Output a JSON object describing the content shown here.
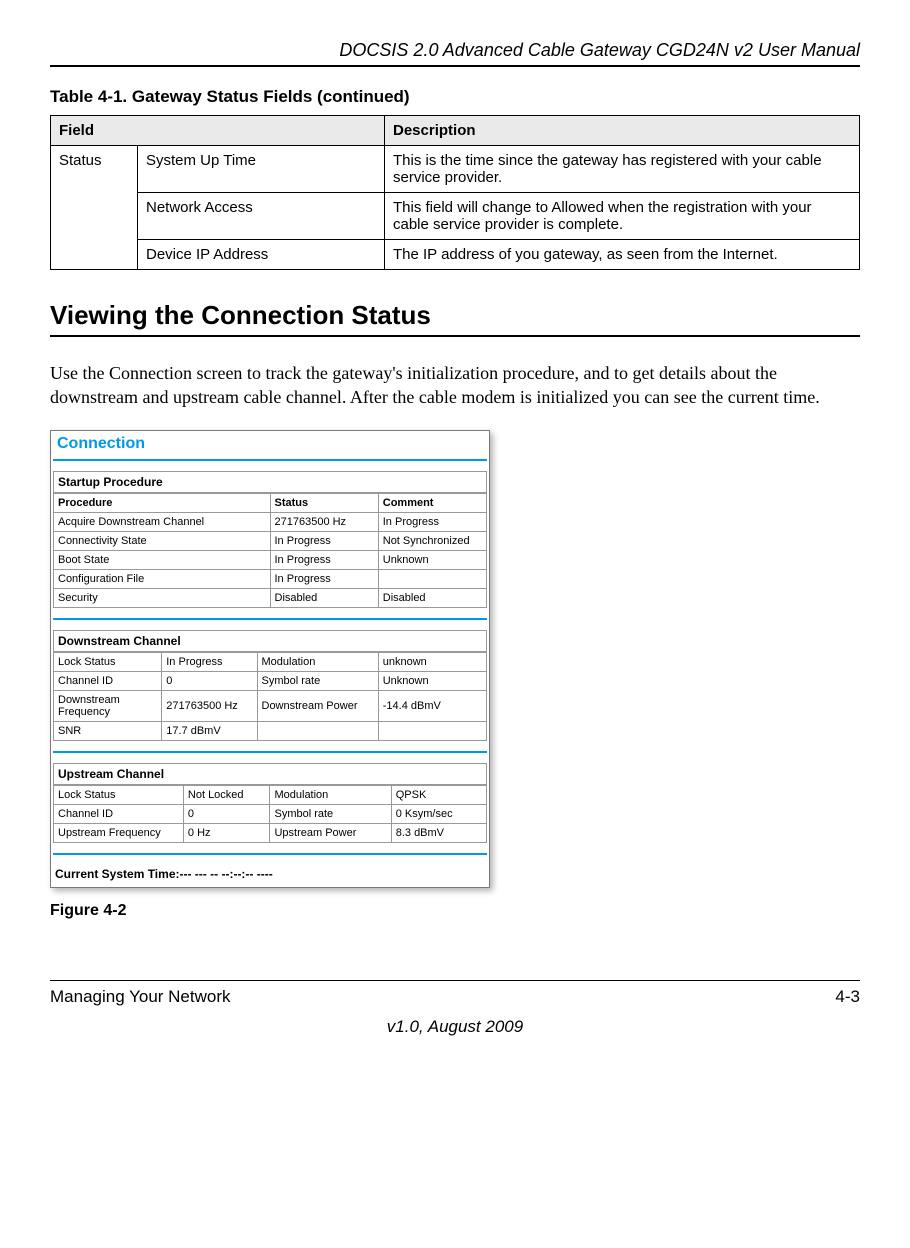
{
  "header": {
    "title": "DOCSIS 2.0 Advanced Cable Gateway CGD24N v2 User Manual"
  },
  "table": {
    "caption": "Table 4-1.  Gateway Status Fields (continued)",
    "head": {
      "c1": "Field",
      "c2": "Description"
    },
    "rows": [
      {
        "group": "Status",
        "field": "System Up Time",
        "desc": "This is the time since the gateway has registered with your cable service provider."
      },
      {
        "group": "",
        "field": "Network Access",
        "desc": "This field will change to Allowed when the registration with your cable service provider is complete."
      },
      {
        "group": "",
        "field": "Device IP Address",
        "desc": "The IP address of you gateway, as seen from the Internet."
      }
    ]
  },
  "section": {
    "heading": "Viewing the Connection Status",
    "para": "Use the Connection screen to track the gateway's initialization procedure, and to get details about the downstream and upstream cable channel. After the cable modem is initialized you can see the current time."
  },
  "screenshot": {
    "title": "Connection",
    "startup": {
      "label": "Startup Procedure",
      "head": {
        "c1": "Procedure",
        "c2": "Status",
        "c3": "Comment"
      },
      "rows": [
        {
          "c1": "Acquire Downstream Channel",
          "c2": "271763500 Hz",
          "c3": "In Progress"
        },
        {
          "c1": "Connectivity State",
          "c2": "In Progress",
          "c3": "Not Synchronized"
        },
        {
          "c1": "Boot State",
          "c2": "In Progress",
          "c3": "Unknown"
        },
        {
          "c1": "Configuration File",
          "c2": "In Progress",
          "c3": ""
        },
        {
          "c1": "Security",
          "c2": "Disabled",
          "c3": "Disabled"
        }
      ]
    },
    "down": {
      "label": "Downstream Channel",
      "rows": [
        {
          "a": "Lock Status",
          "b": "In Progress",
          "c": "Modulation",
          "d": "unknown"
        },
        {
          "a": "Channel ID",
          "b": "0",
          "c": "Symbol rate",
          "d": "Unknown"
        },
        {
          "a": "Downstream Frequency",
          "b": "271763500 Hz",
          "c": "Downstream Power",
          "d": "-14.4 dBmV"
        },
        {
          "a": "SNR",
          "b": "17.7 dBmV",
          "c": "",
          "d": ""
        }
      ]
    },
    "up": {
      "label": "Upstream Channel",
      "rows": [
        {
          "a": "Lock Status",
          "b": "Not Locked",
          "c": "Modulation",
          "d": "QPSK"
        },
        {
          "a": "Channel ID",
          "b": "0",
          "c": "Symbol rate",
          "d": "0 Ksym/sec"
        },
        {
          "a": "Upstream Frequency",
          "b": "0 Hz",
          "c": "Upstream Power",
          "d": "8.3 dBmV"
        }
      ]
    },
    "time": "Current System Time:--- --- -- --:--:-- ----"
  },
  "figure": "Figure 4-2",
  "footer": {
    "left": "Managing Your Network",
    "right": "4-3",
    "version": "v1.0, August 2009"
  }
}
